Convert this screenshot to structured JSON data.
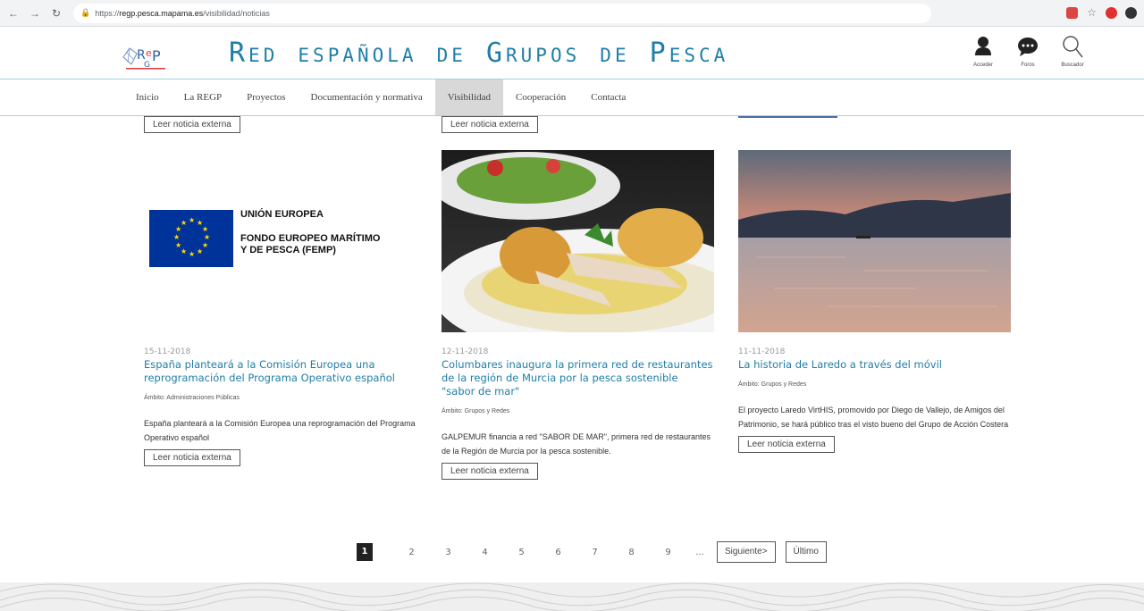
{
  "browser": {
    "url_prefix": "https://",
    "url_main": "regp.pesca.mapama.es",
    "url_path": "/visibilidad/noticias"
  },
  "site": {
    "title": "Red española de Grupos de Pesca",
    "tools": [
      {
        "label": "Acceder",
        "icon": "user-icon"
      },
      {
        "label": "Foros",
        "icon": "chat-bubble-icon"
      },
      {
        "label": "Buscador",
        "icon": "search-icon"
      }
    ]
  },
  "nav": {
    "items": [
      "Inicio",
      "La REGP",
      "Proyectos",
      "Documentación y normativa",
      "Visibilidad",
      "Cooperación",
      "Contacta"
    ],
    "active": "Visibilidad"
  },
  "top_row": {
    "left_button": "Leer noticia externa",
    "middle_button": "Leer noticia externa"
  },
  "news": [
    {
      "date": "15-11-2018",
      "title": "España planteará a la Comisión Europea una reprogramación del Programa Operativo español",
      "ambito": "Ámbito: Administraciones Públicas",
      "summary": "España planteará a la Comisión Europea una reprogramación del Programa Operativo español",
      "button": "Leer noticia externa",
      "image": {
        "line1": "UNIÓN EUROPEA",
        "line2": "FONDO EUROPEO MARÍTIMO",
        "line3": "Y DE PESCA (FEMP)"
      }
    },
    {
      "date": "12-11-2018",
      "title": "Columbares inaugura la primera red de restaurantes de la región de Murcia por la pesca sostenible \"sabor de mar\"",
      "ambito": "Ámbito: Grupos y Redes",
      "summary": "GALPEMUR financia a red \"SABOR DE MAR\", primera red de restaurantes de la Región de Murcia por la pesca sostenible.",
      "button": "Leer noticia externa"
    },
    {
      "date": "11-11-2018",
      "title": "La historia de Laredo a través del móvil",
      "ambito": "Ámbito: Grupos y Redes",
      "summary": "El proyecto Laredo VirtHIS, promovido por Diego de Vallejo, de Amigos del Patrimonio, se hará público tras el visto bueno del Grupo de Acción Costera",
      "button": "Leer noticia externa"
    }
  ],
  "pagination": {
    "current": "1",
    "pages": [
      "2",
      "3",
      "4",
      "5",
      "6",
      "7",
      "8",
      "9"
    ],
    "ellipsis": "...",
    "next": "Siguiente>",
    "last": "Último"
  }
}
